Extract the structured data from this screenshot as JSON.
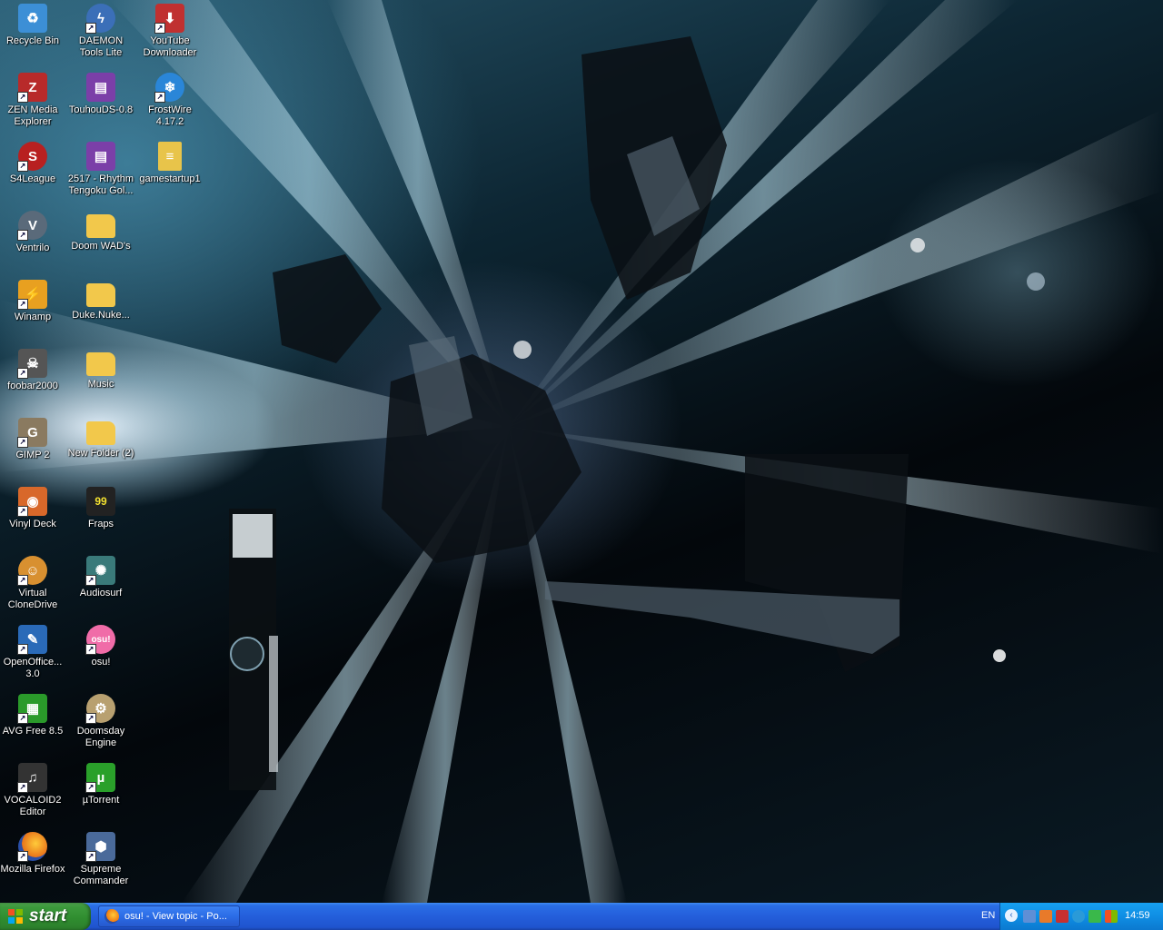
{
  "desktop": {
    "icons": [
      {
        "label": "Recycle Bin",
        "icon": "recycle-bin-icon",
        "color": "#3c8fd6"
      },
      {
        "label": "DAEMON Tools Lite",
        "icon": "daemon-tools-icon",
        "color": "#3b6fb8"
      },
      {
        "label": "YouTube Downloader",
        "icon": "youtube-downloader-icon",
        "color": "#c03030"
      },
      {
        "label": "ZEN Media Explorer",
        "icon": "zen-media-icon",
        "color": "#b82a2a"
      },
      {
        "label": "TouhouDS-0.8",
        "icon": "archive-icon",
        "color": "#7b3fa8"
      },
      {
        "label": "FrostWire 4.17.2",
        "icon": "frostwire-icon",
        "color": "#2a86d8"
      },
      {
        "label": "S4League",
        "icon": "s4league-icon",
        "color": "#b82020"
      },
      {
        "label": "2517 - Rhythm Tengoku Gol...",
        "icon": "archive-icon",
        "color": "#7b3fa8"
      },
      {
        "label": "gamestartup1",
        "icon": "document-icon",
        "color": "#e8c44a"
      },
      {
        "label": "Ventrilo",
        "icon": "ventrilo-icon",
        "color": "#5a6a7a"
      },
      {
        "label": "Doom WAD's",
        "icon": "folder-icon",
        "color": "#f2c84b"
      },
      {
        "label": "Winamp",
        "icon": "winamp-icon",
        "color": "#e8a020"
      },
      {
        "label": "Duke.Nuke...",
        "icon": "folder-icon",
        "color": "#f2c84b"
      },
      {
        "label": "foobar2000",
        "icon": "foobar-icon",
        "color": "#555555"
      },
      {
        "label": "Music",
        "icon": "folder-icon",
        "color": "#f2c84b"
      },
      {
        "label": "GIMP 2",
        "icon": "gimp-icon",
        "color": "#8a7a60"
      },
      {
        "label": "New Folder (2)",
        "icon": "folder-icon",
        "color": "#f2c84b"
      },
      {
        "label": "Vinyl Deck",
        "icon": "vinyl-deck-icon",
        "color": "#d8682a"
      },
      {
        "label": "Fraps",
        "icon": "fraps-icon",
        "color": "#222222"
      },
      {
        "label": "Virtual CloneDrive",
        "icon": "virtual-clonedrive-icon",
        "color": "#d89030"
      },
      {
        "label": "Audiosurf",
        "icon": "audiosurf-icon",
        "color": "#3a7a7a"
      },
      {
        "label": "OpenOffice... 3.0",
        "icon": "openoffice-icon",
        "color": "#2a6ab8"
      },
      {
        "label": "osu!",
        "icon": "osu-icon",
        "color": "#f06ca8"
      },
      {
        "label": "AVG Free 8.5",
        "icon": "avg-icon",
        "color": "#2a9a2a"
      },
      {
        "label": "Doomsday Engine",
        "icon": "doomsday-icon",
        "color": "#b8a070"
      },
      {
        "label": "VOCALOID2 Editor",
        "icon": "vocaloid-icon",
        "color": "#333333"
      },
      {
        "label": "µTorrent",
        "icon": "utorrent-icon",
        "color": "#2aa02a"
      },
      {
        "label": "Mozilla Firefox",
        "icon": "firefox-icon",
        "color": "#e8741a"
      },
      {
        "label": "Supreme Commander",
        "icon": "supreme-commander-icon",
        "color": "#4a6a9a"
      }
    ]
  },
  "taskbar": {
    "start_label": "start",
    "task_button_label": "osu! - View topic - Po...",
    "language": "EN",
    "clock": "14:59"
  },
  "colors": {
    "taskbar": "#245edb",
    "start_button": "#3c9a3c",
    "tray": "#0f8ee4"
  }
}
